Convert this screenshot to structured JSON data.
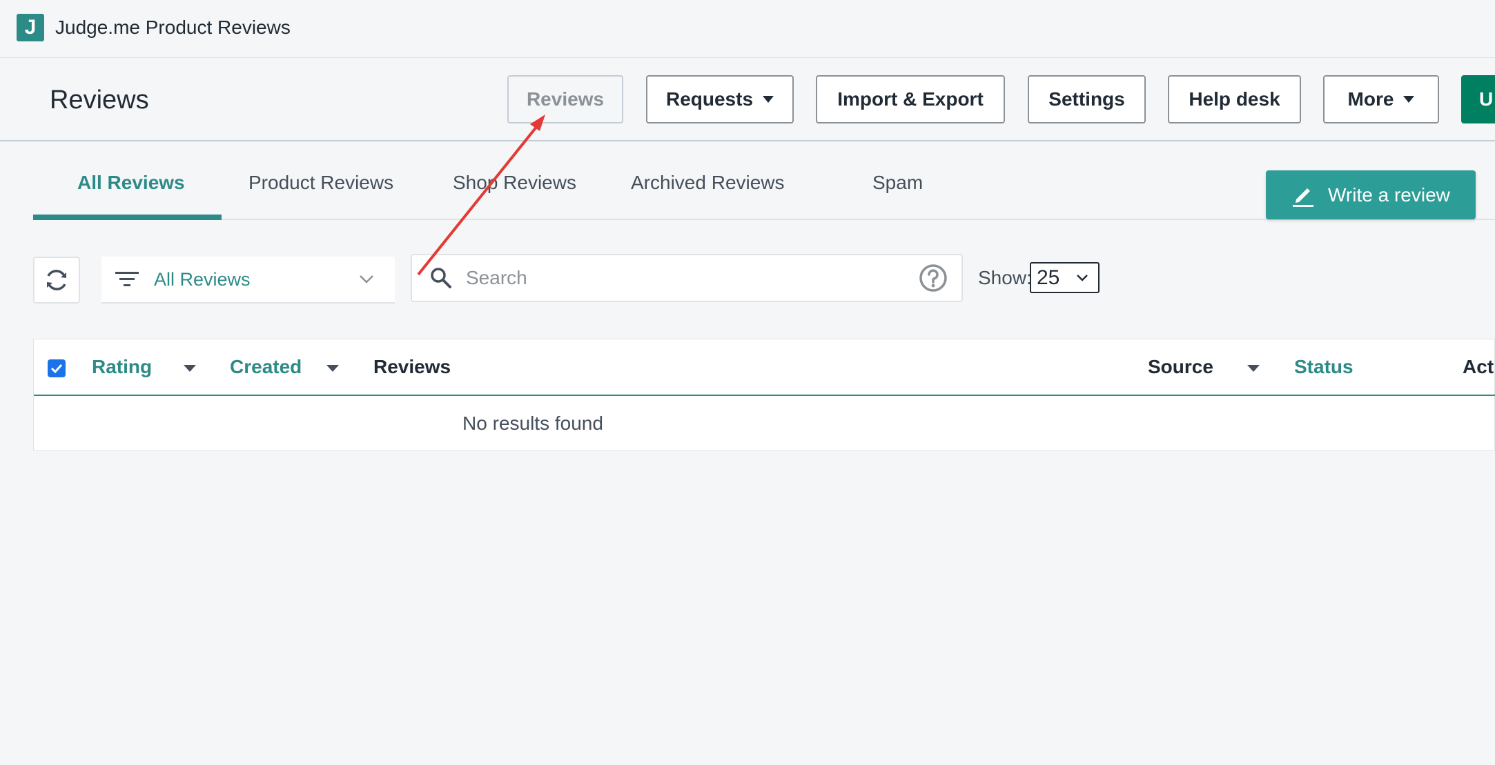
{
  "app": {
    "logo_letter": "J",
    "title": "Judge.me Product Reviews"
  },
  "header": {
    "title": "Reviews",
    "buttons": {
      "reviews": "Reviews",
      "requests": "Requests",
      "import_export": "Import & Export",
      "settings": "Settings",
      "help_desk": "Help desk",
      "more": "More",
      "primary_cut": "U"
    }
  },
  "tabs": {
    "items": [
      "All Reviews",
      "Product Reviews",
      "Shop Reviews",
      "Archived Reviews",
      "Spam"
    ],
    "active": "All Reviews"
  },
  "write_review": {
    "label": "Write a review"
  },
  "toolbar": {
    "filter_value": "All Reviews",
    "search_placeholder": "Search",
    "show_label": "Show:",
    "show_value": "25"
  },
  "table": {
    "columns": [
      "Rating",
      "Created",
      "Reviews",
      "Source",
      "Status",
      "Acti"
    ],
    "empty_text": "No results found"
  },
  "colors": {
    "brand_teal": "#2d8b87",
    "primary_green": "#008060",
    "checkbox_blue": "#1a73e8",
    "annotation_red": "#e53935"
  },
  "icons": [
    "refresh-icon",
    "filter-icon",
    "chevron-down-icon",
    "search-icon",
    "help-icon",
    "pencil-icon",
    "check-icon",
    "caret-down-icon"
  ]
}
